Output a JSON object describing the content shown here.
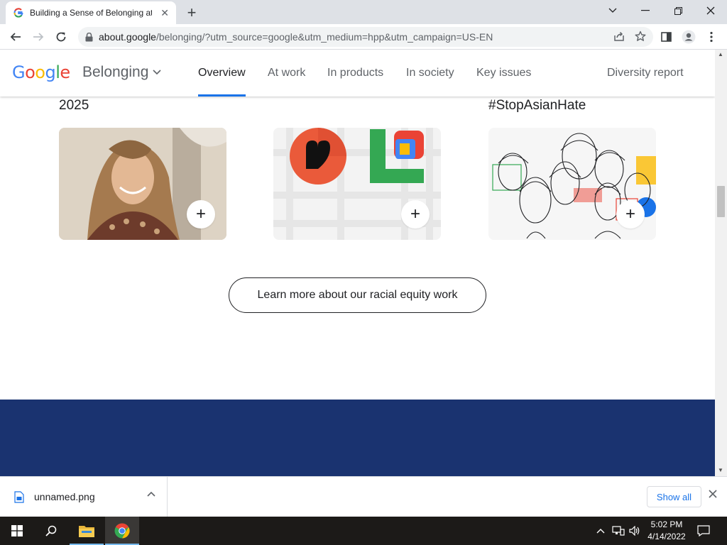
{
  "browser": {
    "tab_title": "Building a Sense of Belonging at",
    "url_host": "about.google",
    "url_rest": "/belonging/?utm_source=google&utm_medium=hpp&utm_campaign=US-EN"
  },
  "site": {
    "logo_letters": [
      "G",
      "o",
      "o",
      "g",
      "l",
      "e"
    ],
    "logo_colors": [
      "#4285F4",
      "#EA4335",
      "#FBBC05",
      "#4285F4",
      "#34A853",
      "#EA4335"
    ],
    "section_title": "Belonging",
    "nav": {
      "overview": "Overview",
      "at_work": "At work",
      "in_products": "In products",
      "in_society": "In society",
      "key_issues": "Key issues",
      "diversity_report": "Diversity report"
    },
    "accent_color": "#1a73e8"
  },
  "cards": {
    "caption_left": "2025",
    "caption_right": "#StopAsianHate",
    "plus": "+"
  },
  "cta": {
    "label": "Learn more about our racial equity work"
  },
  "downloads": {
    "file_name": "unnamed.png",
    "show_all": "Show all"
  },
  "taskbar": {
    "time": "5:02 PM",
    "date": "4/14/2022"
  }
}
